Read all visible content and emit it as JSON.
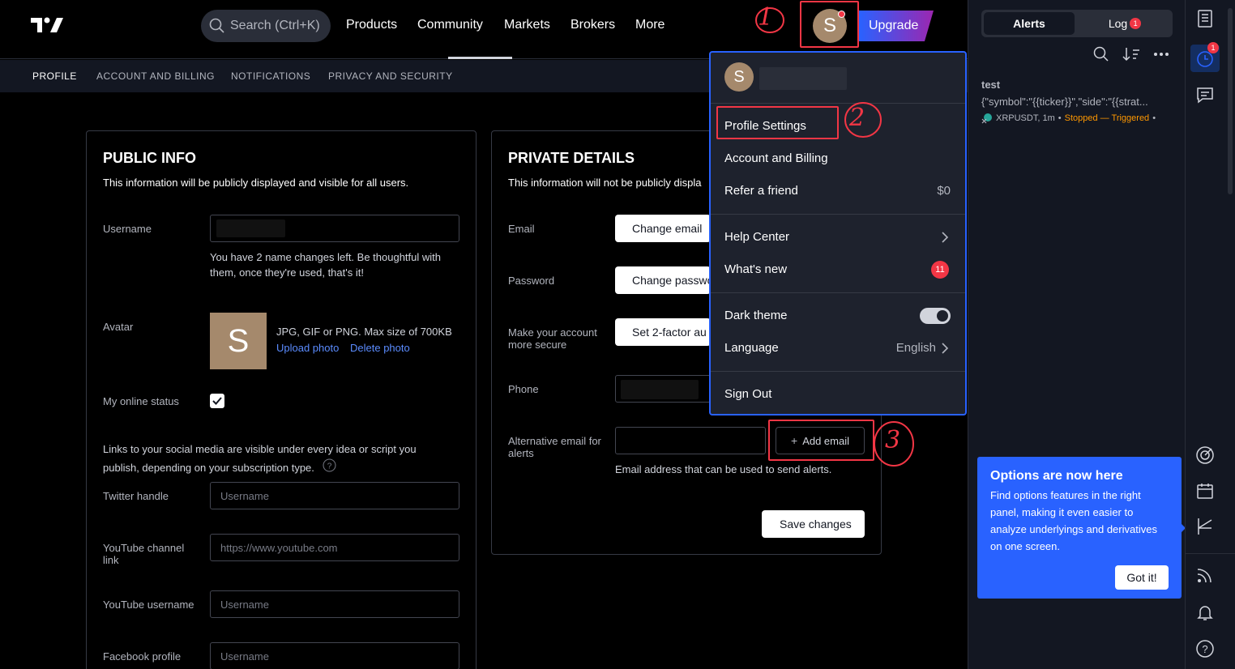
{
  "topnav": {
    "search_placeholder": "Search (Ctrl+K)",
    "items": [
      "Products",
      "Community",
      "Markets",
      "Brokers",
      "More"
    ],
    "avatar_letter": "S",
    "upgrade_label": "Upgrade"
  },
  "subnav": {
    "tabs": [
      "PROFILE",
      "ACCOUNT AND BILLING",
      "NOTIFICATIONS",
      "PRIVACY AND SECURITY"
    ]
  },
  "public_info": {
    "title": "PUBLIC INFO",
    "description": "This information will be publicly displayed and visible for all users.",
    "username_label": "Username",
    "username_note": "You have 2 name changes left. Be thoughtful with them, once they're used, that's it!",
    "avatar_label": "Avatar",
    "avatar_letter": "S",
    "avatar_hint": "JPG, GIF or PNG. Max size of 700KB",
    "upload_photo": "Upload photo",
    "delete_photo": "Delete photo",
    "online_status_label": "My online status",
    "social_note": "Links to your social media are visible under every idea or script you publish, depending on your subscription type.",
    "twitter_label": "Twitter handle",
    "twitter_placeholder": "Username",
    "youtube_channel_label": "YouTube channel link",
    "youtube_channel_placeholder": "https://www.youtube.com",
    "youtube_username_label": "YouTube username",
    "youtube_username_placeholder": "Username",
    "facebook_label": "Facebook profile",
    "facebook_placeholder": "Username"
  },
  "private_details": {
    "title": "PRIVATE DETAILS",
    "description": "This information will not be publicly displa",
    "email_label": "Email",
    "change_email": "Change email",
    "password_label": "Password",
    "change_password": "Change passwo",
    "secure_label": "Make your account more secure",
    "twofactor": "Set 2-factor au",
    "phone_label": "Phone",
    "alt_email_label": "Alternative email for alerts",
    "add_email": "Add email",
    "alt_email_note": "Email address that can be used to send alerts.",
    "save_changes": "Save changes"
  },
  "dropdown": {
    "avatar_letter": "S",
    "profile_settings": "Profile Settings",
    "account_billing": "Account and Billing",
    "refer_friend": "Refer a friend",
    "refer_value": "$0",
    "help_center": "Help Center",
    "whats_new": "What's new",
    "whats_new_count": "11",
    "dark_theme": "Dark theme",
    "language": "Language",
    "language_value": "English",
    "sign_out": "Sign Out"
  },
  "alerts_panel": {
    "tab_alerts": "Alerts",
    "tab_log": "Log",
    "log_count": "1",
    "alert_title": "test",
    "alert_message": "{\"symbol\":\"{{ticker}}\",\"side\":\"{{strat...",
    "alert_symbol": "XRPUSDT, 1m",
    "alert_status": "Stopped — Triggered"
  },
  "tooltip": {
    "title": "Options are now here",
    "body": "Find options features in the right panel, making it even easier to analyze underlyings and derivatives on one screen.",
    "button": "Got it!"
  },
  "toolbar": {
    "alerts_badge": "1"
  },
  "annotations": {
    "step1": "1",
    "step2": "2",
    "step3": "3"
  },
  "colors": {
    "accent": "#2962ff",
    "danger": "#f23645",
    "avatar": "#a5896c",
    "stopped": "#ff9800"
  }
}
